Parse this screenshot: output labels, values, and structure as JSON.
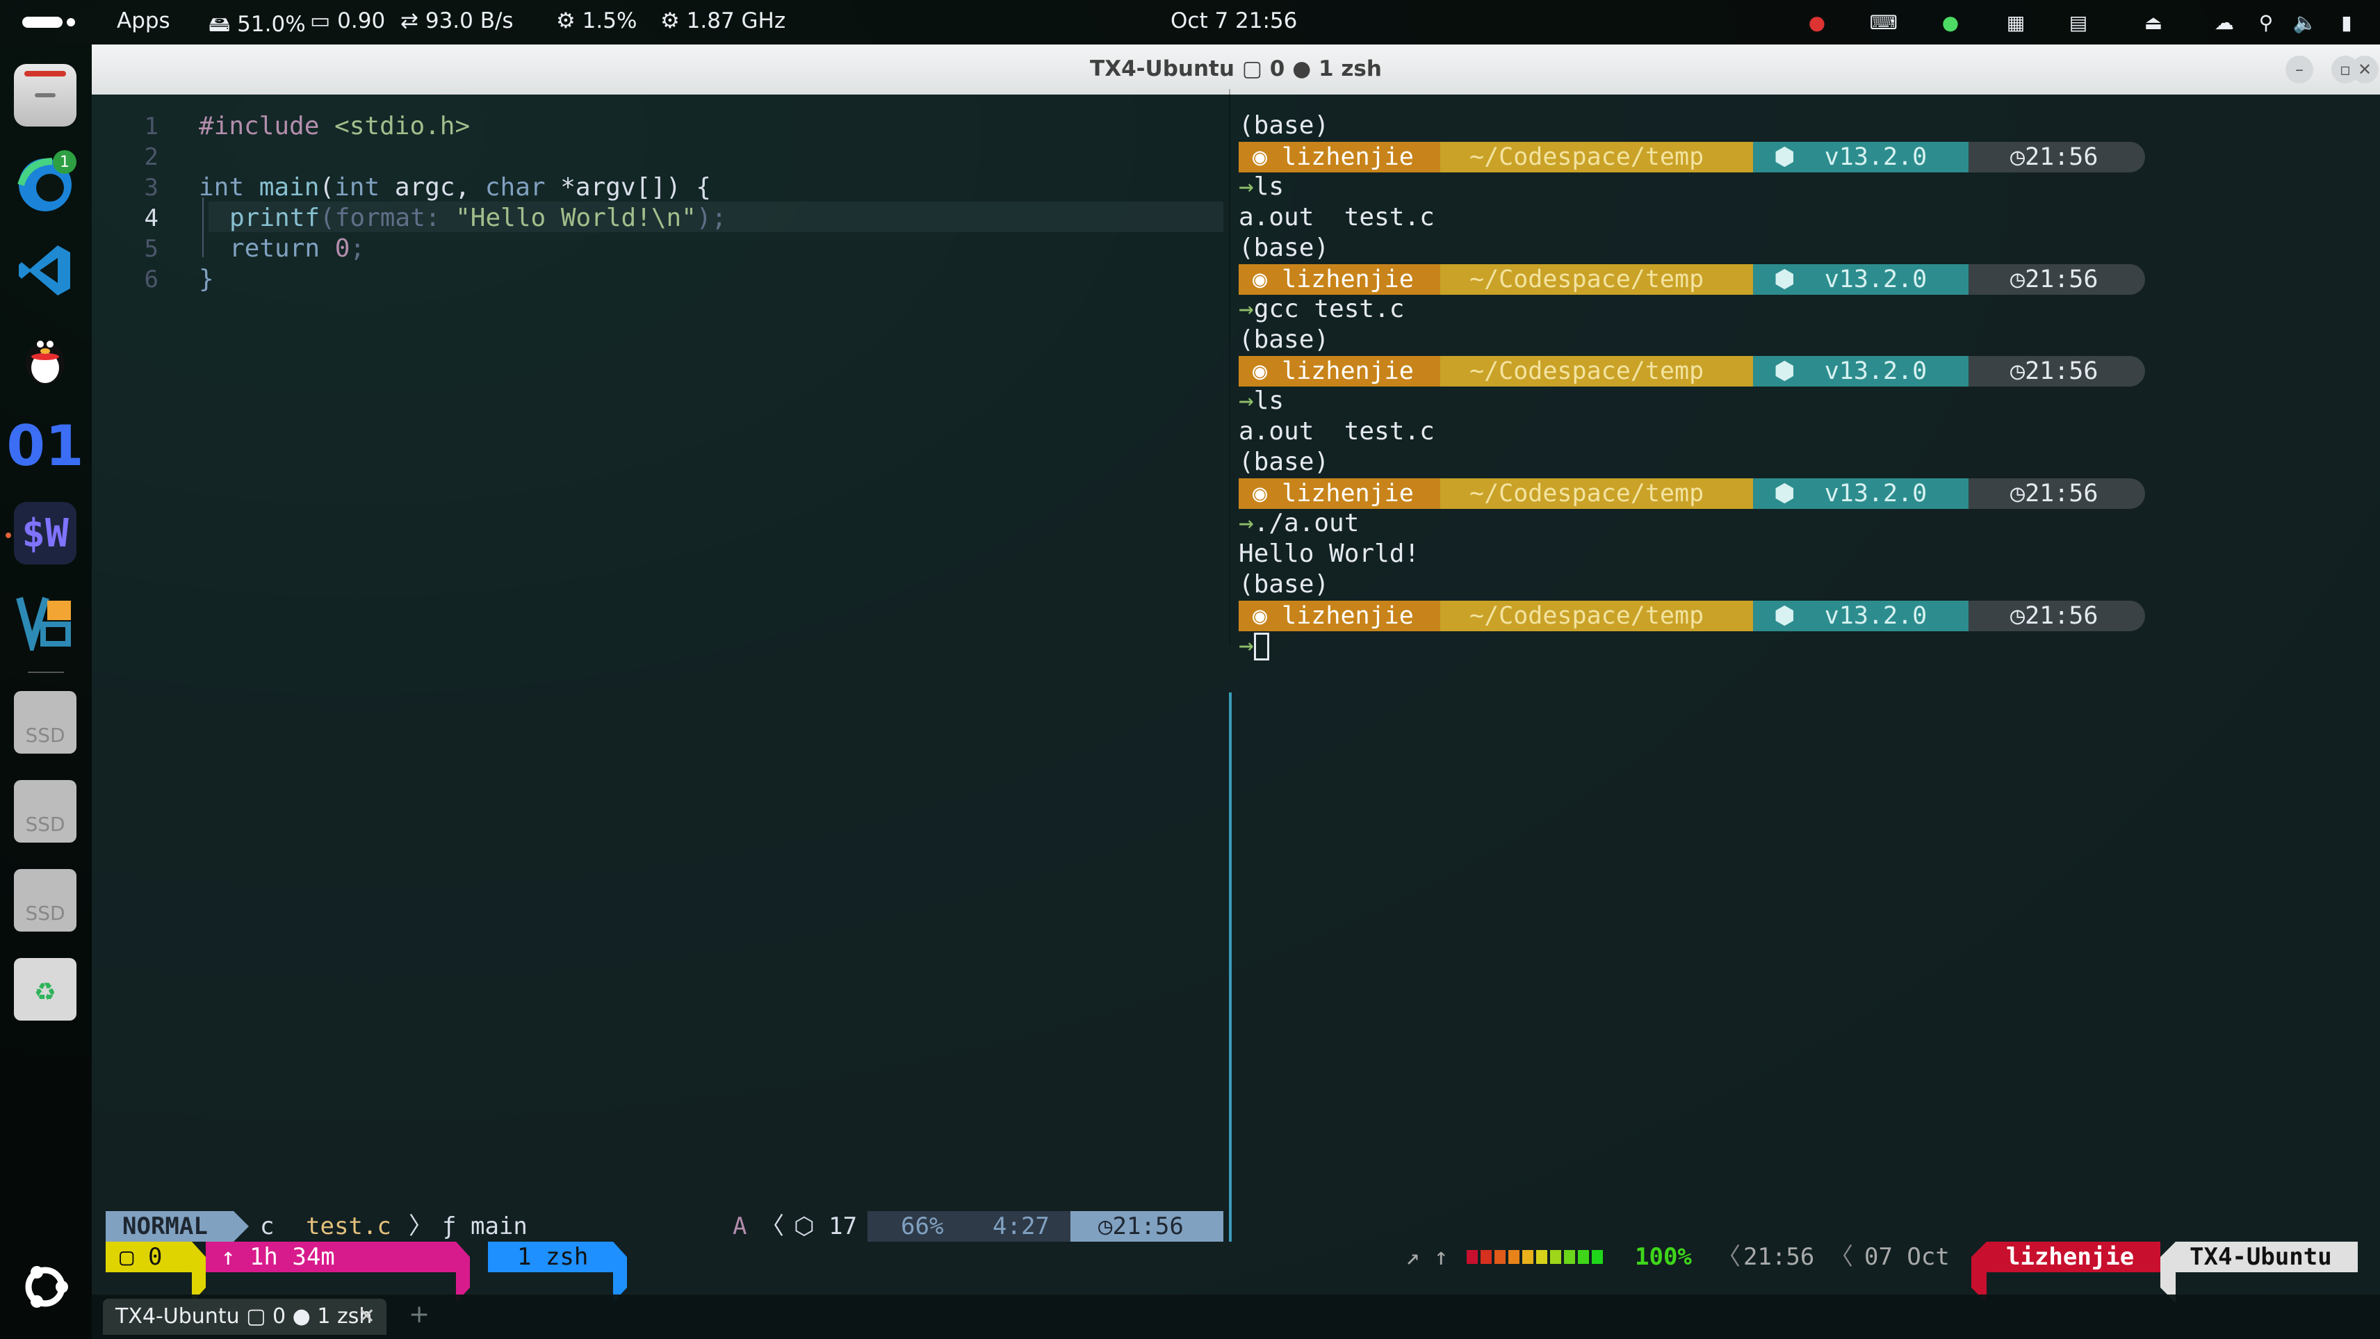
{
  "topbar": {
    "apps": "Apps",
    "mem": "51.0%",
    "load": "0.90",
    "net": "93.0 B/s",
    "cpu": "1.5%",
    "freq": "1.87 GHz",
    "datetime": "Oct 7  21:56"
  },
  "dock": {
    "ssd_label": "SSD",
    "edge_badge": "1"
  },
  "window": {
    "title": "TX4-Ubuntu ▢ 0 ● 1 zsh",
    "min": "–",
    "max": "▫",
    "close": "✕"
  },
  "editor": {
    "line_numbers": [
      "1",
      "2",
      "3",
      "4",
      "5",
      "6"
    ],
    "lines": {
      "l1_directive": "#include",
      "l1_header": "<stdio.h>",
      "l3_a": "int",
      "l3_b": "main",
      "l3_c": "(",
      "l3_d": "int",
      "l3_e": " argc, ",
      "l3_f": "char",
      "l3_g": " *argv[]) {",
      "l4_fn": "printf",
      "l4_hint": "(format: ",
      "l4_str": "\"Hello World!\\n\"",
      "l4_end": ");",
      "l5_kw": "return",
      "l5_num": "0",
      "l5_end": ";",
      "l6": "}"
    }
  },
  "terminal": {
    "base": "(base)",
    "user": "lizhenjie",
    "path": "~/Codespace/temp",
    "node": "v13.2.0",
    "time": "21:56",
    "cmd1": "ls",
    "out1": "a.out  test.c",
    "cmd2": "gcc test.c",
    "cmd3": "ls",
    "out3": "a.out  test.c",
    "cmd4": "./a.out",
    "out4": "Hello World!",
    "arrow": "→"
  },
  "vimstatus": {
    "mode": "NORMAL",
    "lang": "c",
    "file": "test.c",
    "func_icon": "ƒ",
    "func": "main",
    "ale": "A",
    "count": "17",
    "percent": "66%",
    "pos": "4:27",
    "time": "21:56"
  },
  "tmux": {
    "session": "0",
    "uptime": "↑ 1h 34m",
    "window": "1 zsh",
    "arrows": "↗ ↑",
    "battery": "100%",
    "time": "21:56",
    "date": "07 Oct",
    "user": "lizhenjie",
    "host": "TX4-Ubuntu"
  },
  "tabbar": {
    "tab_label": "TX4-Ubuntu ▢ 0 ● 1 zsh",
    "add": "+"
  },
  "colors": {
    "prompt_orange": "#c8841a",
    "prompt_yellow": "#c9a227",
    "prompt_teal": "#2d8d8e",
    "prompt_dark": "#3a4245",
    "vim_mode_bg": "#81a1c1",
    "tmux_yellow": "#e0d400",
    "tmux_pink": "#d81b8c",
    "tmux_blue": "#1e90ff",
    "tmux_red": "#c8102e"
  }
}
